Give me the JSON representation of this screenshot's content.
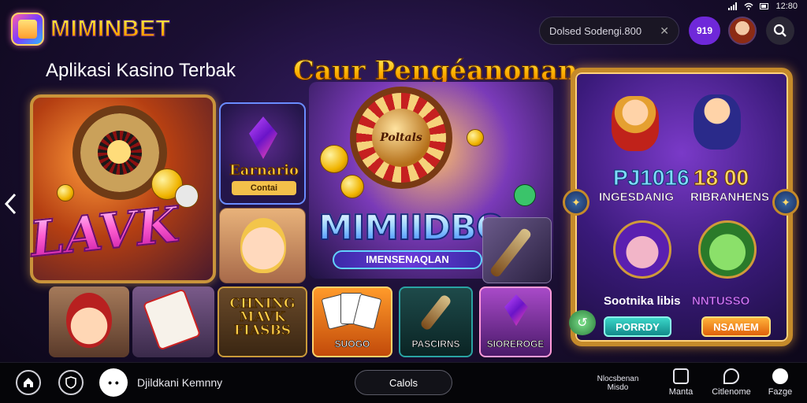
{
  "status_bar": {
    "time": "12:80"
  },
  "header": {
    "brand": "MIMINBET",
    "search": {
      "value": "Dolsed Sodengi.800",
      "clear_icon": "close-icon"
    },
    "user_pill": "919",
    "headline": "Aplikasi Kasino Terbak",
    "headline_highlight": "Caur Pengéanonan"
  },
  "cards": {
    "big_left": {
      "title": "LAVK"
    },
    "mid_top": {
      "title": "Earnario",
      "subtitle": "Contai"
    },
    "center": {
      "wheel_label": "Poltals",
      "title": "MIMIIDBO",
      "subtitle": "IMENSENAQLAN"
    },
    "bottom_row": [
      {
        "name": "hat-kid-card",
        "label": ""
      },
      {
        "name": "dice-card",
        "label": ""
      },
      {
        "name": "chning-card",
        "label": "CHNING MAVK FIASBS"
      },
      {
        "name": "suogo-card",
        "label": "SUOGO"
      },
      {
        "name": "bascirns-card",
        "label": "PASCIRNS"
      },
      {
        "name": "sioreroge-card",
        "label": "SIOREROGE"
      }
    ]
  },
  "right_panel": {
    "value_left": "PJ1016",
    "value_right": "18 00",
    "label_left": "INGESDANIG",
    "label_right": "RIBRANHENS",
    "name_left": "Sootnika libis",
    "name_right": "NNTUSSO",
    "button_left": "PORRDY",
    "button_right": "NSAMEM"
  },
  "bottom_nav": {
    "user_name": "Djildkani Kemnny",
    "center_pill": "Calols",
    "small_text": "Nlocsbenan Misdo",
    "items": [
      {
        "label": "Manta"
      },
      {
        "label": "Citlenome"
      },
      {
        "label": "Fazge"
      }
    ]
  },
  "colors": {
    "accent_purple": "#6f28d9",
    "gold_frame": "#c58a2a",
    "background": "#1b0f33"
  }
}
